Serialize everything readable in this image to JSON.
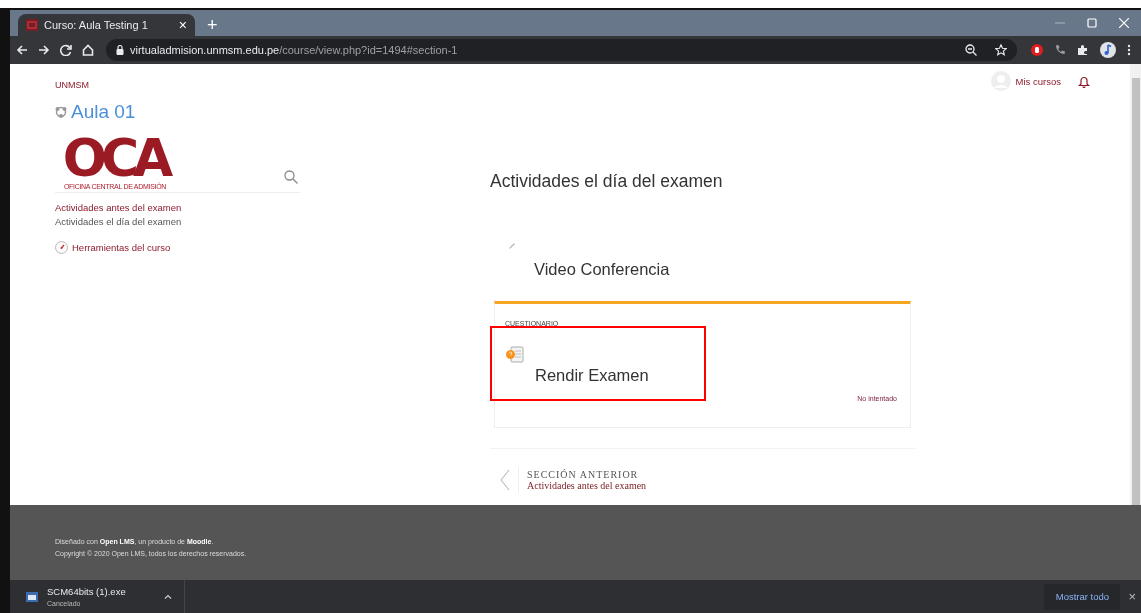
{
  "browser": {
    "tab_title": "Curso: Aula Testing 1",
    "tab_close": "×",
    "new_tab": "+",
    "url_host": "virtualadmision.unmsm.edu.pe",
    "url_path": "/course/view.php?id=1494#section-1"
  },
  "header": {
    "site": "UNMSM",
    "course_title": "Aula 01",
    "user_menu": "Mis cursos"
  },
  "logo": {
    "mark": "OCA",
    "caption": "OFICINA CENTRAL DE ADMISIÓN"
  },
  "sidebar": {
    "sections": [
      {
        "label": "Actividades antes del examen",
        "selected": false
      },
      {
        "label": "Actividades el día del examen",
        "selected": true
      }
    ],
    "tools": "Herramientas del curso"
  },
  "section": {
    "title": "Actividades el día del examen",
    "activities": [
      {
        "kind": "label",
        "title": "Video Conferencia"
      },
      {
        "kind": "quiz",
        "type_label": "CUESTIONARIO",
        "title": "Rendir Examen",
        "status": "No intentado",
        "highlighted": true
      }
    ]
  },
  "previous_section": {
    "label": "SECCIÓN ANTERIOR",
    "name": "Actividades antes del examen"
  },
  "footer": {
    "line_1": "Diseñado con **Open LMS**, un producto de **Moodle**.",
    "line_2": "Copyright © 2020 Open LMS, todos los derechos reservados."
  },
  "downloads": {
    "file": "SCM64bits (1).exe",
    "status": "Cancelado",
    "show_all": "Mostrar todo",
    "close": "×"
  }
}
